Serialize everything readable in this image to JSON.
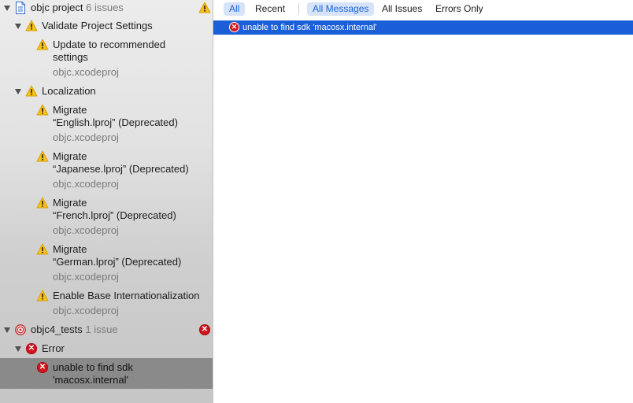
{
  "navigator": {
    "project": {
      "name": "objc project",
      "count": "6 issues"
    },
    "groups": [
      {
        "label": "Validate Project Settings",
        "items": [
          {
            "line1": "Update to recommended",
            "line2": "settings",
            "file": "objc.xcodeproj"
          }
        ]
      },
      {
        "label": "Localization",
        "items": [
          {
            "line1": "Migrate",
            "line2": "“English.lproj” (Deprecated)",
            "file": "objc.xcodeproj"
          },
          {
            "line1": "Migrate",
            "line2": "“Japanese.lproj” (Deprecated)",
            "file": "objc.xcodeproj"
          },
          {
            "line1": "Migrate",
            "line2": "“French.lproj” (Deprecated)",
            "file": "objc.xcodeproj"
          },
          {
            "line1": "Migrate",
            "line2": "“German.lproj” (Deprecated)",
            "file": "objc.xcodeproj"
          },
          {
            "line1": "Enable Base Internationalization",
            "file": "objc.xcodeproj"
          }
        ]
      }
    ],
    "target": {
      "name": "objc4_tests",
      "count": "1 issue"
    },
    "error_group": {
      "label": "Error"
    },
    "error_item": {
      "line1": "unable to find sdk",
      "line2": "'macosx.internal'"
    }
  },
  "filters": {
    "scope": [
      "All",
      "Recent"
    ],
    "type": [
      "All Messages",
      "All Issues",
      "Errors Only"
    ],
    "active_scope": "All",
    "active_type": "All Messages"
  },
  "log": {
    "messages": [
      {
        "icon": "error-icon",
        "text": "unable to find sdk 'macosx.internal'"
      }
    ]
  },
  "colors": {
    "selection": "#1a5fd8",
    "error": "#d0151c",
    "warning": "#f4c01d"
  }
}
